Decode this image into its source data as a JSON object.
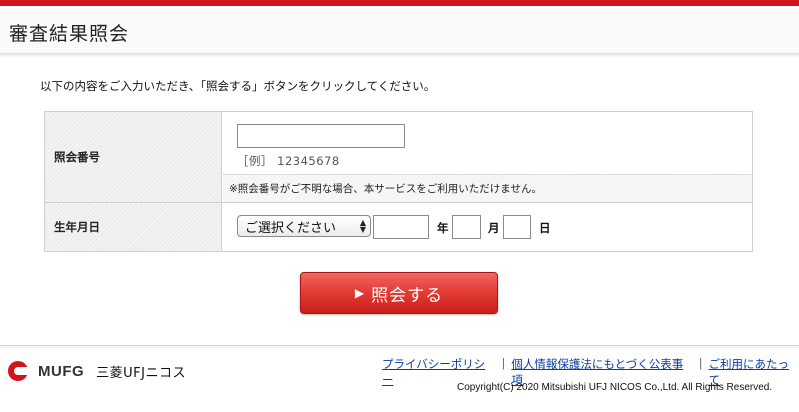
{
  "header": {
    "title": "審査結果照会"
  },
  "instruction": "以下の内容をご入力いただき、「照会する」ボタンをクリックしてください。",
  "form": {
    "inquiry": {
      "label": "照会番号",
      "value": "",
      "example": "［例］ 12345678",
      "note": "※照会番号がご不明な場合、本サービスをご利用いただけません。"
    },
    "birth": {
      "label": "生年月日",
      "era_select": "ご選択ください",
      "year_value": "",
      "month_value": "",
      "day_value": "",
      "year_unit": "年",
      "month_unit": "月",
      "day_unit": "日"
    }
  },
  "submit": {
    "label": "照会する",
    "icon": "play-arrow-icon"
  },
  "footer": {
    "logo_text": "MUFG",
    "logo_sub": "三菱UFJニコス",
    "links": [
      "プライバシーポリシー",
      "個人情報保護法にもとづく公表事項",
      "ご利用にあたって"
    ],
    "copyright": "Copyright(C) 2020 Mitsubishi UFJ NICOS Co.,Ltd. All Rights Reserved."
  },
  "colors": {
    "brand_red": "#d0151c",
    "link_blue": "#0b3c9c"
  }
}
